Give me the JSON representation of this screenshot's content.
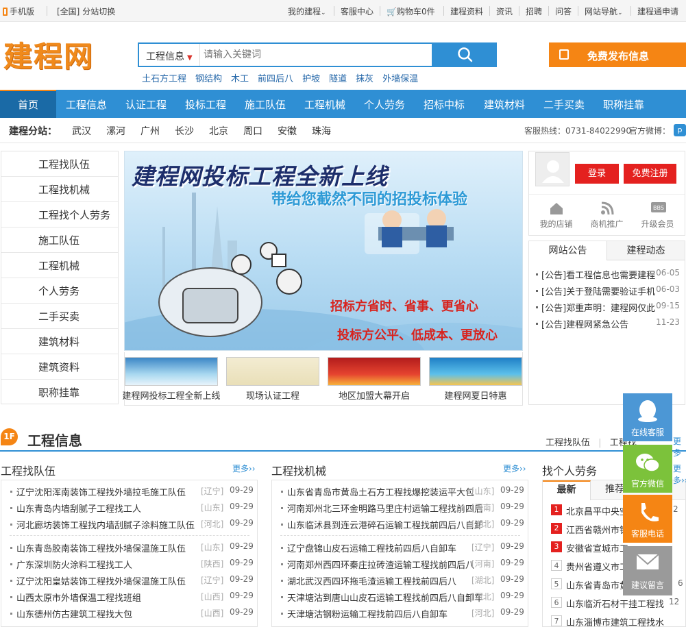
{
  "topbar": {
    "mobile": "手机版",
    "region": "[全国]",
    "switch": "分站切换",
    "my_account": "我的建程",
    "service": "客服中心",
    "cart": "购物车0件",
    "materials": "建程资料",
    "news": "资讯",
    "jobs": "招聘",
    "qa": "问答",
    "sitenav": "网站导航",
    "apply": "建程通申请"
  },
  "header": {
    "logo": "建程网",
    "search_category": "工程信息",
    "search_placeholder": "请输入关键词",
    "hotwords": [
      "土石方工程",
      "钢结构",
      "木工",
      "前四后八",
      "护坡",
      "隧道",
      "抹灰",
      "外墙保温"
    ],
    "publish": "免费发布信息"
  },
  "nav": [
    "首页",
    "工程信息",
    "认证工程",
    "投标工程",
    "施工队伍",
    "工程机械",
    "个人劳务",
    "招标中标",
    "建筑材料",
    "二手买卖",
    "职称挂靠"
  ],
  "substations": {
    "label": "建程分站：",
    "cities": [
      "武汉",
      "漯河",
      "广州",
      "长沙",
      "北京",
      "周口",
      "安徽",
      "珠海"
    ],
    "hotline": "客服热线：0731-84022990",
    "weibo": "官方微博："
  },
  "categories": [
    "工程找队伍",
    "工程找机械",
    "工程找个人劳务",
    "施工队伍",
    "工程机械",
    "个人劳务",
    "二手买卖",
    "建筑材料",
    "建筑资料",
    "职称挂靠"
  ],
  "banner": {
    "title": "建程网投标工程全新上线",
    "subtitle": "带给您截然不同的招投标体验",
    "line1": "招标方省时、省事、更省心",
    "line2": "投标方公平、低成本、更放心"
  },
  "thumbs": [
    "建程网投标工程全新上线",
    "现场认证工程",
    "地区加盟大幕开启",
    "建程网夏日特惠"
  ],
  "user": {
    "login": "登录",
    "register": "免费注册",
    "shop": "我的店铺",
    "promo": "商机推广",
    "upgrade": "升级会员"
  },
  "notices": {
    "tab1": "网站公告",
    "tab2": "建程动态",
    "items": [
      {
        "title": "[公告]看工程信息也需要建程",
        "date": "06-05"
      },
      {
        "title": "[公告]关于登陆需要验证手机",
        "date": "06-03"
      },
      {
        "title": "[公告]郑重声明：建程网仅此",
        "date": "09-15"
      },
      {
        "title": "[公告]建程网紧急公告",
        "date": "11-23"
      }
    ]
  },
  "floor1": {
    "badge": "1F",
    "title": "工程信息",
    "links": [
      "工程找队伍",
      "工程找",
      "更多"
    ],
    "col1": {
      "title": "工程找队伍",
      "more": "更多››",
      "rows": [
        {
          "t": "辽宁沈阳浑南装饰工程找外墙拉毛施工队伍",
          "r": "[辽宁]",
          "d": "09-29"
        },
        {
          "t": "山东青岛内墙刮腻子工程找工人",
          "r": "[山东]",
          "d": "09-29"
        },
        {
          "t": "河北廊坊装饰工程找内墙刮腻子涂料施工队伍",
          "r": "[河北]",
          "d": "09-29"
        },
        {
          "t": "山东青岛胶南装饰工程找外墙保温施工队伍",
          "r": "[山东]",
          "d": "09-29"
        },
        {
          "t": "广东深圳防火涂料工程找工人",
          "r": "[陕西]",
          "d": "09-29"
        },
        {
          "t": "辽宁沈阳皇姑装饰工程找外墙保温施工队伍",
          "r": "[辽宁]",
          "d": "09-29"
        },
        {
          "t": "山西太原市外墙保温工程找班组",
          "r": "[山西]",
          "d": "09-29"
        },
        {
          "t": "山东德州仿古建筑工程找大包",
          "r": "[山西]",
          "d": "09-29"
        }
      ]
    },
    "col2": {
      "title": "工程找机械",
      "more": "更多››",
      "rows": [
        {
          "t": "山东省青岛市黄岛土石方工程找爆挖装运平大包",
          "r": "[山东]",
          "d": "09-29"
        },
        {
          "t": "河南郑州北三环金明路马里庄村运输工程找前四后",
          "r": "[河南]",
          "d": "09-29"
        },
        {
          "t": "山东临沭县到连云港碎石运输工程找前四后八自卸",
          "r": "[湖北]",
          "d": "09-29"
        },
        {
          "t": "辽宁盘锦山皮石运输工程找前四后八自卸车",
          "r": "[辽宁]",
          "d": "09-29"
        },
        {
          "t": "河南郑州西四环秦庄拉砖渣运输工程找前四后八",
          "r": "[河南]",
          "d": "09-29"
        },
        {
          "t": "湖北武汉西四环拖毛渣运输工程找前四后八",
          "r": "[湖北]",
          "d": "09-29"
        },
        {
          "t": "天津塘沽到唐山山皮石运输工程找前四后八自卸车",
          "r": "[河北]",
          "d": "09-29"
        },
        {
          "t": "天津塘沽钢粉运输工程找前四后八自卸车",
          "r": "[河北]",
          "d": "09-29"
        }
      ]
    },
    "col3": {
      "title": "找个人劳务",
      "more": "更多››",
      "tab1": "最新",
      "tab2": "推荐",
      "rows": [
        {
          "n": "1",
          "t": "北京昌平中央空",
          "d": "2"
        },
        {
          "n": "2",
          "t": "江西省赣州市铁",
          "d": ""
        },
        {
          "n": "3",
          "t": "安徽省宣城市工",
          "d": ""
        },
        {
          "n": "4",
          "t": "贵州省遵义市工",
          "d": ""
        },
        {
          "n": "5",
          "t": "山东省青岛市黄",
          "d": "6"
        },
        {
          "n": "6",
          "t": "山东临沂石材干挂工程找",
          "d": "12"
        },
        {
          "n": "7",
          "t": "山东淄博市建筑工程找水",
          "d": ""
        }
      ]
    }
  },
  "float": {
    "online": "在线客服",
    "wechat": "官方微信",
    "phone": "客服电话",
    "feedback": "建议留言"
  },
  "colors": {
    "primary": "#2f8fd4",
    "nav_active": "#1a6aa6",
    "orange": "#f58514",
    "red": "#e4211f",
    "green": "#7cc23b",
    "float_blue": "#4c97d5"
  }
}
